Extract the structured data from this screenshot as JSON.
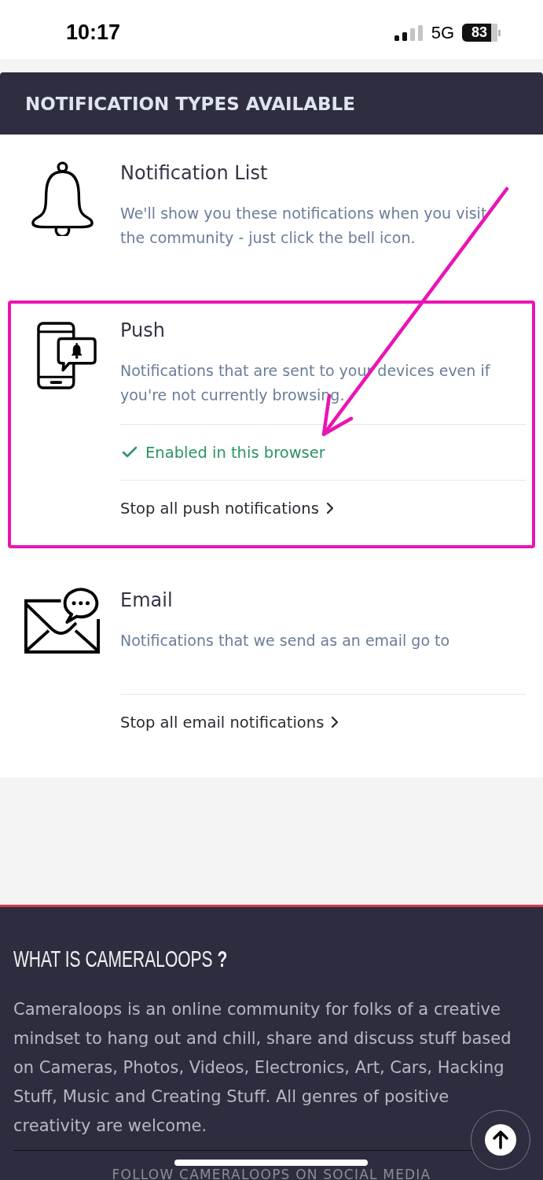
{
  "status_bar": {
    "time": "10:17",
    "network": "5G",
    "battery": "83"
  },
  "panel": {
    "title": "NOTIFICATION TYPES AVAILABLE",
    "types": [
      {
        "kind": "bell",
        "title": "Notification List",
        "description": "We'll show you these notifications when you visit the community - just click the bell icon.",
        "highlighted": false
      },
      {
        "kind": "push",
        "title": "Push",
        "description": "Notifications that are sent to your devices even if you're not currently browsing.",
        "highlighted": true,
        "status": {
          "text": "Enabled in this browser",
          "enabled": true
        },
        "action": "Stop all push notifications"
      },
      {
        "kind": "email",
        "title": "Email",
        "description": "Notifications that we send as an email go to",
        "highlighted": false,
        "action": "Stop all email notifications"
      }
    ]
  },
  "footer": {
    "heading": "WHAT IS CAMERALOOPS **?**",
    "about": "Cameraloops is an online community for folks of a creative mindset to hang out and chill, share and discuss stuff based on Cameras, Photos, Videos, Electronics, Art, Cars, Hacking Stuff, Music and Creating Stuff. All genres of positive creativity are welcome.",
    "follow_heading": "FOLLOW CAMERALOOPS ON SOCIAL MEDIA"
  }
}
